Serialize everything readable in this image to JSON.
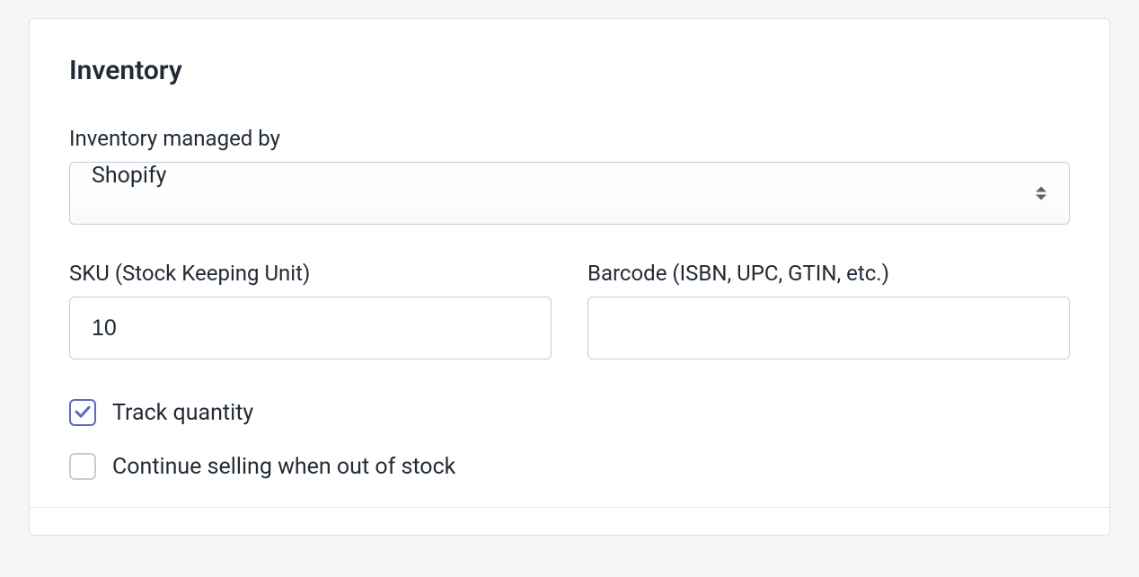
{
  "inventory": {
    "title": "Inventory",
    "managed_by": {
      "label": "Inventory managed by",
      "value": "Shopify"
    },
    "sku": {
      "label": "SKU (Stock Keeping Unit)",
      "value": "10"
    },
    "barcode": {
      "label": "Barcode (ISBN, UPC, GTIN, etc.)",
      "value": ""
    },
    "track_quantity": {
      "label": "Track quantity",
      "checked": true
    },
    "continue_selling": {
      "label": "Continue selling when out of stock",
      "checked": false
    }
  }
}
